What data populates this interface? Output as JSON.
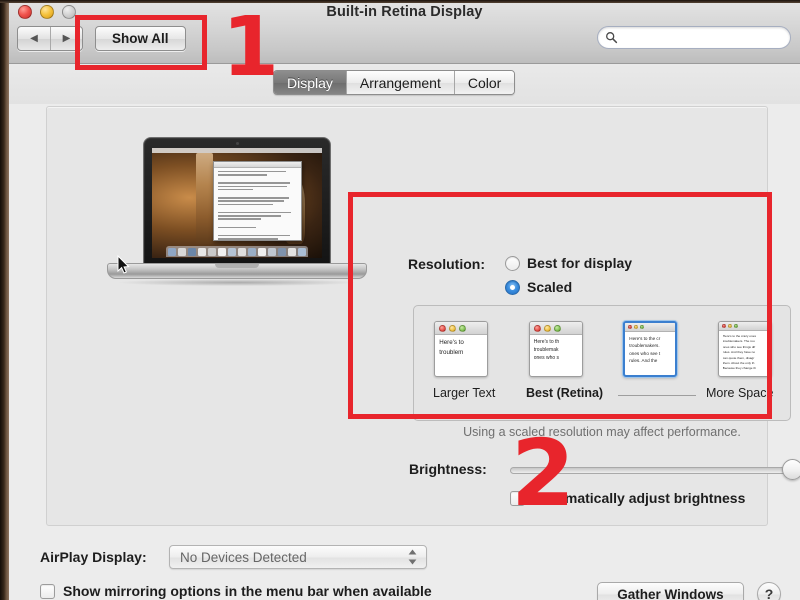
{
  "window": {
    "title": "Built-in Retina Display",
    "traffic_lights": [
      "close-red",
      "minimize-yellow",
      "zoom-disabled"
    ]
  },
  "toolbar": {
    "back_label": "◀",
    "forward_label": "▶",
    "show_all_label": "Show All",
    "search_placeholder": "",
    "search_value": "",
    "search_icon": "search-icon"
  },
  "tabs": [
    {
      "label": "Display",
      "active": true
    },
    {
      "label": "Arrangement",
      "active": false
    },
    {
      "label": "Color",
      "active": false
    }
  ],
  "resolution": {
    "label": "Resolution:",
    "options": [
      {
        "label": "Best for display",
        "selected": false
      },
      {
        "label": "Scaled",
        "selected": true
      }
    ]
  },
  "scaled_options": {
    "items": [
      {
        "label": "Larger Text",
        "bold": false,
        "selected": false,
        "size": "lg",
        "lines": [
          "Here's to",
          "troublem"
        ]
      },
      {
        "label": "Best (Retina)",
        "bold": true,
        "selected": false,
        "size": "mid",
        "lines": [
          "Here's to th",
          "troublemak",
          "ones who s"
        ]
      },
      {
        "label": "",
        "bold": false,
        "selected": true,
        "size": "sel",
        "lines": [
          "Here's to the cr",
          "troublemakers.",
          "ones who see t",
          "rules. And the"
        ]
      },
      {
        "label": "More Space",
        "bold": false,
        "selected": false,
        "size": "tiny",
        "lines": [
          "Here's to the crazy ones",
          "troublemakers. The rou",
          "ones who see things dif",
          "rules. And they have no",
          "can quote them, disagr",
          "them. About the only th",
          "Because they change th"
        ]
      }
    ],
    "note": "Using a scaled resolution may affect performance."
  },
  "brightness": {
    "label": "Brightness:",
    "value_percent": 100,
    "auto_adjust_label": "Automatically adjust brightness",
    "auto_adjust_checked": false
  },
  "airplay": {
    "label": "AirPlay Display:",
    "selected_value": "No Devices Detected",
    "mirror_label": "Show mirroring options in the menu bar when available",
    "mirror_checked": false
  },
  "footer": {
    "gather_label": "Gather Windows",
    "help_label": "?"
  },
  "annotations": {
    "color": "#e8252c",
    "markers": [
      {
        "number": "1",
        "target": "show-all-button"
      },
      {
        "number": "2",
        "target": "scaled-resolution-section"
      }
    ]
  }
}
